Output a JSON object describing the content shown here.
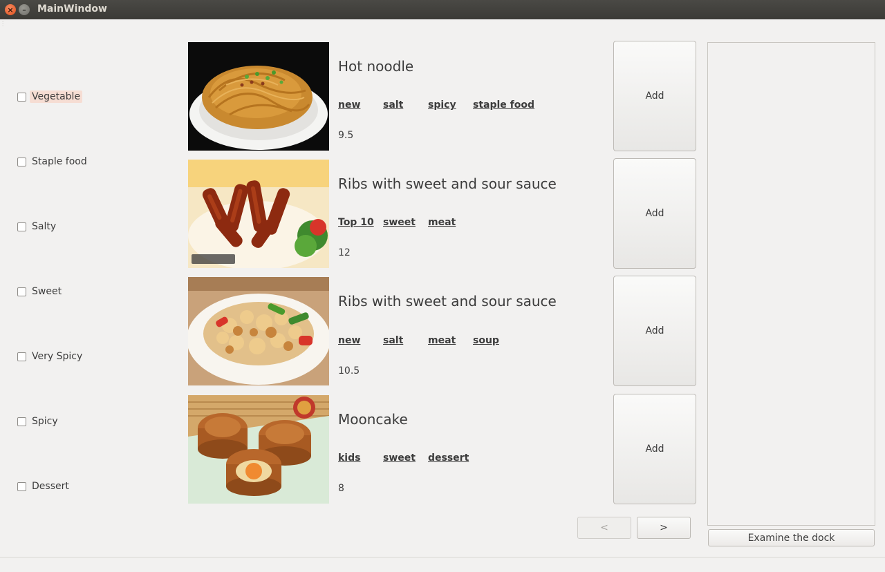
{
  "window": {
    "title": "MainWindow"
  },
  "filters": [
    {
      "label": "Vegetable",
      "checked": false
    },
    {
      "label": "Staple food",
      "checked": false
    },
    {
      "label": "Salty",
      "checked": false
    },
    {
      "label": "Sweet",
      "checked": false
    },
    {
      "label": "Very Spicy",
      "checked": false
    },
    {
      "label": "Spicy",
      "checked": false
    },
    {
      "label": "Dessert",
      "checked": false
    }
  ],
  "dishes": [
    {
      "name": "Hot noodle",
      "tags": [
        "new",
        "salt",
        "spicy",
        "staple food"
      ],
      "price": "9.5",
      "add_label": "Add"
    },
    {
      "name": "Ribs with sweet and sour sauce",
      "tags": [
        "Top 10",
        "sweet",
        "meat"
      ],
      "price": "12",
      "add_label": "Add"
    },
    {
      "name": "Ribs with sweet and sour sauce",
      "tags": [
        "new",
        "salt",
        "meat",
        "soup"
      ],
      "price": "10.5",
      "add_label": "Add"
    },
    {
      "name": "Mooncake",
      "tags": [
        "kids",
        "sweet",
        "dessert"
      ],
      "price": "8",
      "add_label": "Add"
    }
  ],
  "pager": {
    "prev_label": "<",
    "next_label": ">"
  },
  "dock": {
    "button_label": "Examine the dock"
  }
}
